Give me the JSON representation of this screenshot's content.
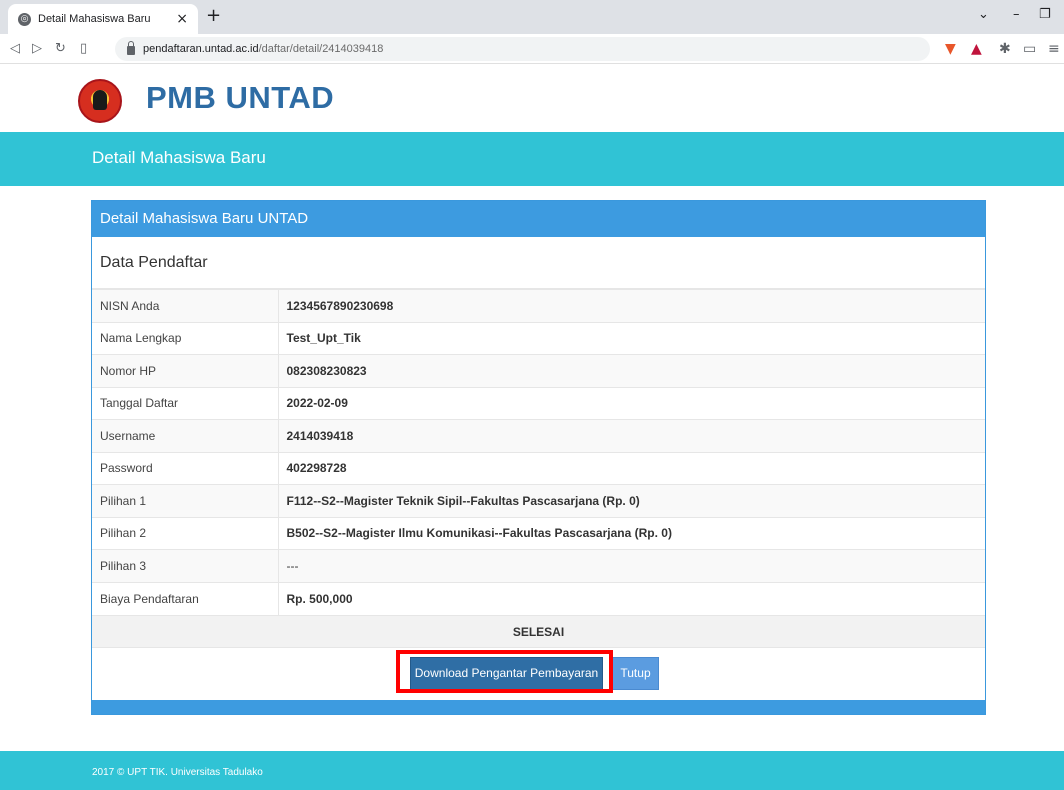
{
  "browser": {
    "tab_title": "Detail Mahasiswa Baru",
    "tab_close": "×",
    "new_tab": "+",
    "url_host": "pendaftaran.untad.ac.id",
    "url_path": "/daftar/detail/2414039418",
    "icons": [
      "globe-icon",
      "back-icon",
      "forward-icon",
      "reload-icon",
      "bookmark-icon",
      "lock-icon",
      "brave-icon",
      "triangle-icon",
      "extensions-icon",
      "window-icon",
      "menu-icon"
    ]
  },
  "header": {
    "brand": "PMB UNTAD",
    "subtitle": "Detail Mahasiswa Baru"
  },
  "panel": {
    "title": "Detail Mahasiswa Baru UNTAD",
    "section": "Data Pendaftar",
    "rows": [
      {
        "label": "NISN Anda",
        "value": "1234567890230698"
      },
      {
        "label": "Nama Lengkap",
        "value": "Test_Upt_Tik"
      },
      {
        "label": "Nomor HP",
        "value": "082308230823"
      },
      {
        "label": "Tanggal Daftar",
        "value": "2022-02-09"
      },
      {
        "label": "Username",
        "value": "2414039418"
      },
      {
        "label": "Password",
        "value": "402298728"
      },
      {
        "label": "Pilihan 1",
        "value": "F112--S2--Magister Teknik Sipil--Fakultas Pascasarjana (Rp. 0)"
      },
      {
        "label": "Pilihan 2",
        "value": "B502--S2--Magister Ilmu Komunikasi--Fakultas Pascasarjana (Rp. 0)"
      },
      {
        "label": "Pilihan 3",
        "value": "---"
      },
      {
        "label": "Biaya Pendaftaran",
        "value": "Rp. 500,000"
      }
    ],
    "done_label": "SELESAI",
    "download_button": "Download Pengantar Pembayaran",
    "close_button": "Tutup"
  },
  "footer": {
    "text": "2017 © UPT TIK. Universitas Tadulako"
  },
  "colors": {
    "brand_blue": "#2e6ca4",
    "teal": "#30c3d5",
    "panel_blue": "#3d9be0",
    "highlight_red": "#ff0000"
  }
}
